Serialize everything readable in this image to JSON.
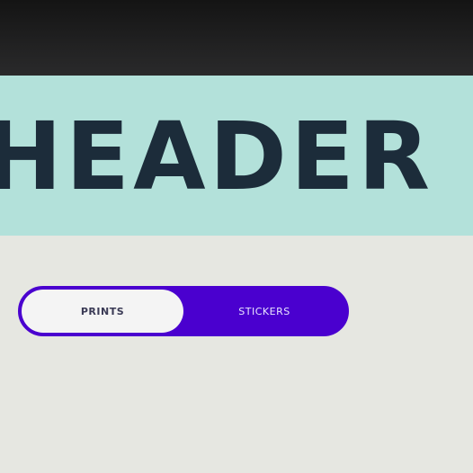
{
  "header": {
    "title": "HEADER"
  },
  "toggle": {
    "options": [
      "PRINTS",
      "STICKERS"
    ],
    "selected": "PRINTS"
  },
  "colors": {
    "bezel": "#1a1a1a",
    "header_background": "#b3e1da",
    "header_text": "#1c2c3a",
    "page_background": "#e6e7e1",
    "toggle_accent": "#4a00cf",
    "toggle_active_background": "#f4f4f4"
  }
}
